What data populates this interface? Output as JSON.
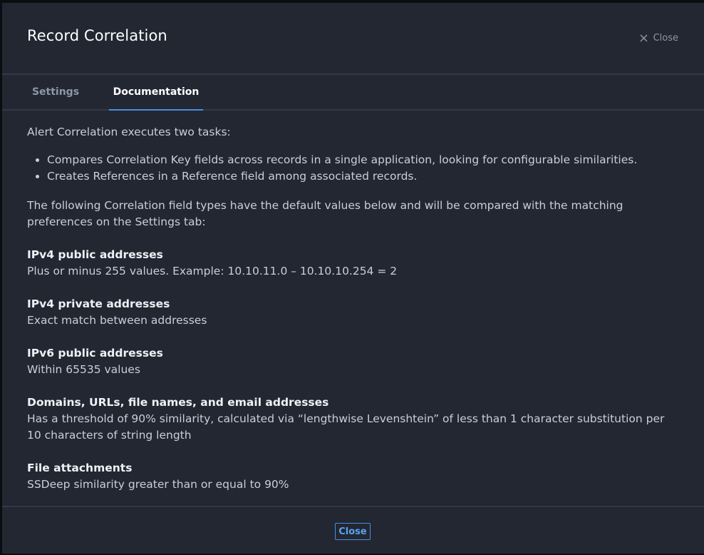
{
  "header": {
    "title": "Record Correlation",
    "close_label": "Close"
  },
  "tabs": [
    {
      "label": "Settings",
      "active": false
    },
    {
      "label": "Documentation",
      "active": true
    }
  ],
  "content": {
    "intro": "Alert Correlation executes two tasks:",
    "bullets": [
      "Compares Correlation Key fields across records in a single application, looking for configurable similarities.",
      "Creates References in a Reference field among associated records."
    ],
    "paragraph": "The following Correlation field types have the default values below and will be compared with the matching preferences on the Settings tab:",
    "sections": [
      {
        "title": "IPv4 public addresses",
        "text": "Plus or minus 255 values. Example: 10.10.11.0 – 10.10.10.254 = 2"
      },
      {
        "title": "IPv4 private addresses",
        "text": "Exact match between addresses"
      },
      {
        "title": "IPv6 public addresses",
        "text": "Within 65535 values"
      },
      {
        "title": "Domains, URLs, file names, and email addresses",
        "text": "Has a threshold of 90% similarity, calculated via “lengthwise Levenshtein” of less than 1 character substitution per 10 characters of string length"
      },
      {
        "title": "File attachments",
        "text": "SSDeep similarity greater than or equal to 90%"
      }
    ]
  },
  "footer": {
    "close_label": "Close"
  },
  "colors": {
    "background": "#222732",
    "accent": "#4a8fde",
    "title": "#ffffff",
    "text": "#c9cfd8",
    "muted": "#8e97a6"
  }
}
